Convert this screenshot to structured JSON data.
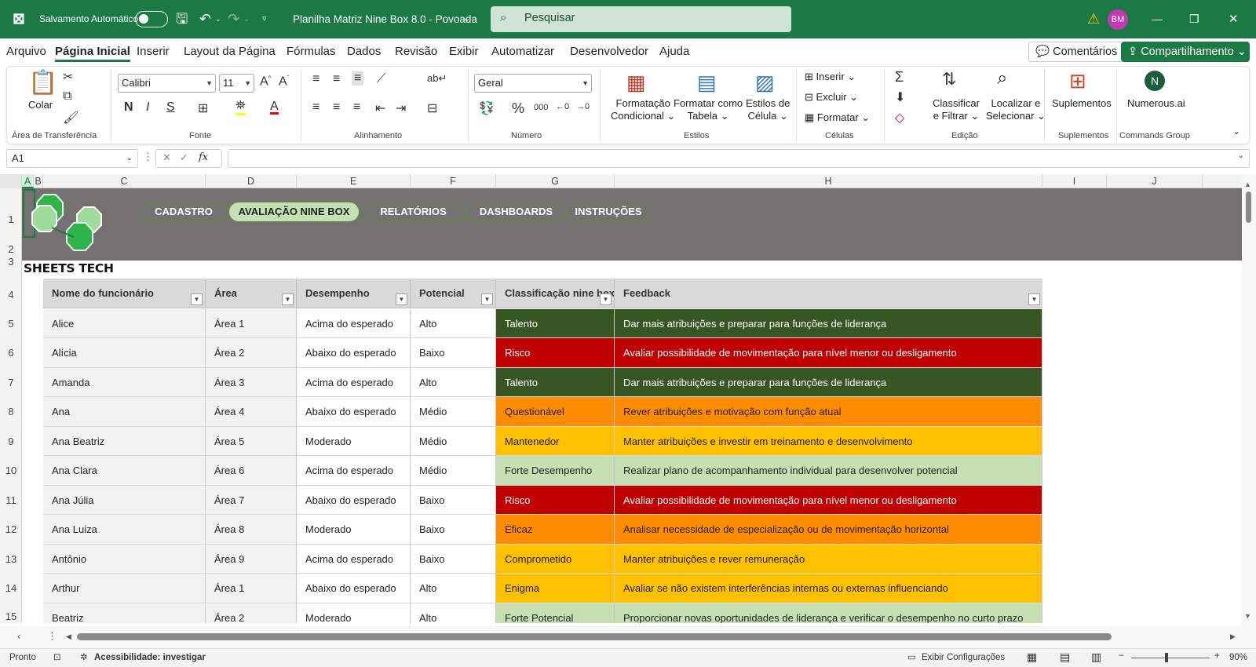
{
  "titlebar": {
    "autosave_label": "Salvamento Automático",
    "file_name": "Planilha Matriz Nine Box 8.0 - Povoada",
    "search_placeholder": "Pesquisar",
    "avatar_initials": "BM",
    "window_minimize": "—",
    "window_restore": "❐",
    "window_close": "✕"
  },
  "menu": {
    "items": [
      "Arquivo",
      "Página Inicial",
      "Inserir",
      "Layout da Página",
      "Fórmulas",
      "Dados",
      "Revisão",
      "Exibir",
      "Automatizar",
      "Desenvolvedor",
      "Ajuda"
    ],
    "comments": "Comentários",
    "share": "Compartilhamento"
  },
  "ribbon": {
    "clipboard": {
      "paste": "Colar",
      "label": "Área de Transferência"
    },
    "font": {
      "family": "Calibri",
      "size": "11",
      "bold": "N",
      "italic": "I",
      "underline": "S",
      "label": "Fonte"
    },
    "alignment": {
      "label": "Alinhamento"
    },
    "number": {
      "format": "Geral",
      "percent": "%",
      "thousands": "000",
      "label": "Número"
    },
    "styles": {
      "conditional1": "Formatação",
      "conditional2": "Condicional",
      "table1": "Formatar como",
      "table2": "Tabela",
      "cell1": "Estilos de",
      "cell2": "Célula",
      "label": "Estilos"
    },
    "cells": {
      "insert": "Inserir",
      "delete": "Excluir",
      "format": "Formatar",
      "label": "Células"
    },
    "editing": {
      "sort1": "Classificar",
      "sort2": "e Filtrar",
      "find1": "Localizar e",
      "find2": "Selecionar",
      "label": "Edição"
    },
    "addins": {
      "button": "Suplementos",
      "label": "Suplementos"
    },
    "commands": {
      "button": "Numerous.ai",
      "label": "Commands Group"
    }
  },
  "formula_bar": {
    "name_box": "A1",
    "fx": "fx",
    "content": ""
  },
  "columns": [
    "A",
    "B",
    "C",
    "D",
    "E",
    "F",
    "G",
    "H",
    "I",
    "J"
  ],
  "rows": [
    "1",
    "2",
    "3",
    "4",
    "5",
    "6",
    "7",
    "8",
    "9",
    "10",
    "11",
    "12",
    "13",
    "14",
    "15"
  ],
  "banner": {
    "nav": [
      "CADASTRO",
      "AVALIAÇÃO NINE BOX",
      "RELATÓRIOS",
      "DASHBOARDS",
      "INSTRUÇÕES"
    ],
    "active": "AVALIAÇÃO NINE BOX",
    "brand": "SHEETS TECH"
  },
  "table": {
    "headers": [
      "Nome do funcionário",
      "Área",
      "Desempenho",
      "Potencial",
      "Classificação nine box",
      "Feedback"
    ],
    "rows": [
      {
        "nome": "Alice",
        "area": "Área 1",
        "desempenho": "Acima do esperado",
        "potencial": "Alto",
        "classificacao": "Talento",
        "feedback": "Dar mais atribuições e preparar para funções de liderança",
        "bg": "#375623",
        "fg": "#ffffff"
      },
      {
        "nome": "Alícia",
        "area": "Área 2",
        "desempenho": "Abaixo do esperado",
        "potencial": "Baixo",
        "classificacao": "Risco",
        "feedback": "Avaliar possibilidade de movimentação para nível menor ou desligamento",
        "bg": "#c00000",
        "fg": "#ffffff"
      },
      {
        "nome": "Amanda",
        "area": "Área 3",
        "desempenho": "Acima do esperado",
        "potencial": "Alto",
        "classificacao": "Talento",
        "feedback": "Dar mais atribuições e preparar para funções de liderança",
        "bg": "#375623",
        "fg": "#ffffff"
      },
      {
        "nome": "Ana",
        "area": "Área 4",
        "desempenho": "Abaixo do esperado",
        "potencial": "Médio",
        "classificacao": "Questionável",
        "feedback": "Rever atribuições e motivação com função atual",
        "bg": "#ff8c00",
        "fg": "#222222"
      },
      {
        "nome": "Ana Beatriz",
        "area": "Área 5",
        "desempenho": "Moderado",
        "potencial": "Médio",
        "classificacao": "Mantenedor",
        "feedback": "Manter atribuições e investir em treinamento e desenvolvimento",
        "bg": "#ffc000",
        "fg": "#222222"
      },
      {
        "nome": "Ana Clara",
        "area": "Área 6",
        "desempenho": "Acima do esperado",
        "potencial": "Médio",
        "classificacao": "Forte Desempenho",
        "feedback": "Realizar plano de acompanhamento individual para desenvolver potencial",
        "bg": "#c6e0b4",
        "fg": "#222222"
      },
      {
        "nome": "Ana Júlia",
        "area": "Área 7",
        "desempenho": "Abaixo do esperado",
        "potencial": "Baixo",
        "classificacao": "Risco",
        "feedback": "Avaliar possibilidade de movimentação para nível menor ou desligamento",
        "bg": "#c00000",
        "fg": "#ffffff"
      },
      {
        "nome": "Ana Luiza",
        "area": "Área 8",
        "desempenho": "Moderado",
        "potencial": "Baixo",
        "classificacao": "Eficaz",
        "feedback": "Analisar necessidade de especialização ou de movimentação horizontal",
        "bg": "#ff8c00",
        "fg": "#222222"
      },
      {
        "nome": "Antônio",
        "area": "Área 9",
        "desempenho": "Acima do esperado",
        "potencial": "Baixo",
        "classificacao": "Comprometido",
        "feedback": "Manter atribuições e rever remuneração",
        "bg": "#ffc000",
        "fg": "#222222"
      },
      {
        "nome": "Arthur",
        "area": "Área 1",
        "desempenho": "Abaixo do esperado",
        "potencial": "Alto",
        "classificacao": "Enigma",
        "feedback": "Avaliar se não existem interferências internas ou externas influenciando",
        "bg": "#ffc000",
        "fg": "#222222"
      },
      {
        "nome": "Beatriz",
        "area": "Área 2",
        "desempenho": "Moderado",
        "potencial": "Alto",
        "classificacao": "Forte Potencial",
        "feedback": "Proporcionar novas oportunidades de liderança e verificar o desempenho no curto prazo",
        "bg": "#c6e0b4",
        "fg": "#222222"
      }
    ]
  },
  "statusbar": {
    "ready": "Pronto",
    "accessibility": "Acessibilidade: investigar",
    "display_settings": "Exibir Configurações",
    "zoom": "90%"
  },
  "colors": {
    "excel_green": "#1b7a43",
    "banner_gray": "#767171",
    "nav_active": "#c6e0b4"
  }
}
